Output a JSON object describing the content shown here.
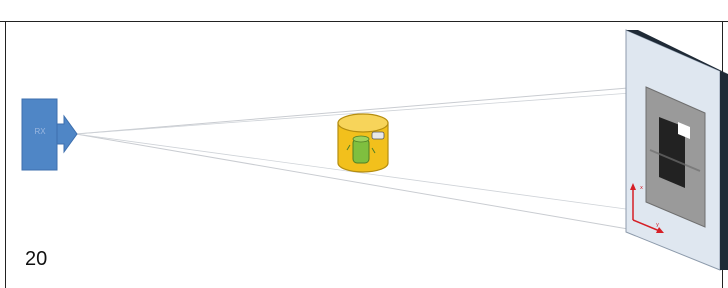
{
  "slide": {
    "page_number": "20",
    "source_label": "RX",
    "colors": {
      "source": "#4f86c6",
      "rays": "#c9ccd1",
      "object_body": "#f2c01c",
      "object_inner": "#7fbf3f",
      "detector_face": "#dfe7f0",
      "detector_edge": "#1f2a36",
      "shadow_outer": "#9a9a9a",
      "shadow_inner": "#222222",
      "axes": "#d61f26"
    },
    "icons": [
      "x-ray-source-icon",
      "sample-cylinder-icon",
      "detector-plate-icon",
      "axes-icon"
    ]
  }
}
